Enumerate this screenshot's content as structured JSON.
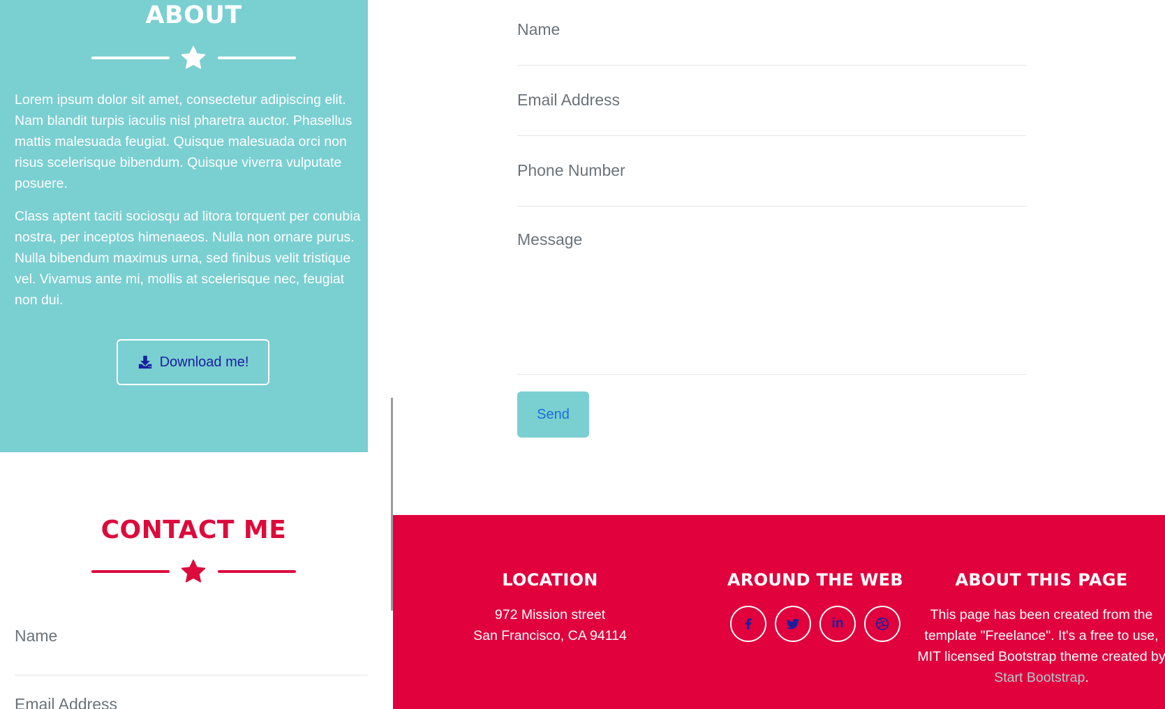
{
  "about": {
    "title": "ABOUT",
    "paragraph1": "Lorem ipsum dolor sit amet, consectetur adipiscing elit. Nam blandit turpis iaculis nisl pharetra auctor. Phasellus mattis malesuada feugiat. Quisque malesuada orci non risus scelerisque bibendum. Quisque viverra vulputate posuere.",
    "paragraph2": "Class aptent taciti sociosqu ad litora torquent per conubia nostra, per inceptos himenaeos. Nulla non ornare purus. Nulla bibendum maximus urna, sed finibus velit tristique vel. Vivamus ante mi, mollis at scelerisque nec, feugiat non dui.",
    "download_label": "Download me!"
  },
  "contact_left": {
    "title": "CONTACT ME",
    "name_label": "Name",
    "email_label": "Email Address"
  },
  "form": {
    "name_label": "Name",
    "email_label": "Email Address",
    "phone_label": "Phone Number",
    "message_label": "Message",
    "send_label": "Send"
  },
  "footer": {
    "location": {
      "title": "LOCATION",
      "line1": "972 Mission street",
      "line2": "San Francisco, CA 94114"
    },
    "web": {
      "title": "AROUND THE WEB",
      "icons": [
        "facebook-icon",
        "twitter-icon",
        "linkedin-icon",
        "dribbble-icon"
      ],
      "linkedin_text": "in"
    },
    "about_page": {
      "title": "ABOUT THIS PAGE",
      "text": "This page has been created from the template \"Freelance\". It's a free to use, MIT licensed Bootstrap theme created by ",
      "link": "Start Bootstrap",
      "end": "."
    }
  },
  "colors": {
    "teal": "#7acfd1",
    "crimson": "#e0013d",
    "contact_title": "#dc0b3c",
    "link_navy": "#1a1fa0"
  }
}
